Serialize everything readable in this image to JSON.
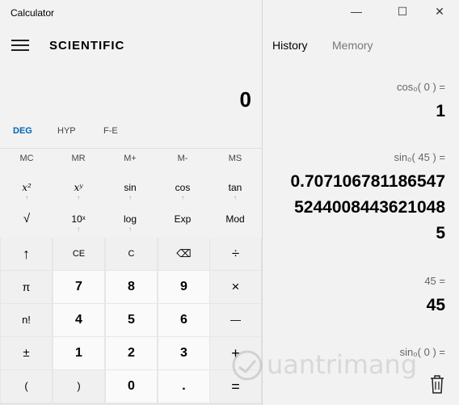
{
  "window": {
    "title": "Calculator",
    "controls": {
      "minimize": "—",
      "maximize": "☐",
      "close": "✕"
    }
  },
  "calculator": {
    "mode": "SCIENTIFIC",
    "display": "0",
    "angle_modes": [
      "DEG",
      "HYP",
      "F-E"
    ],
    "memory_buttons": [
      "MC",
      "MR",
      "M+",
      "M-",
      "MS"
    ],
    "sci_row1": [
      "x²",
      "xʸ",
      "sin",
      "cos",
      "tan"
    ],
    "sci_row2": [
      "√",
      "10ˣ",
      "log",
      "Exp",
      "Mod"
    ],
    "second_arrow": "↑",
    "keypad": [
      [
        "↑",
        "CE",
        "C",
        "⌫",
        "÷"
      ],
      [
        "π",
        "7",
        "8",
        "9",
        "×"
      ],
      [
        "n!",
        "4",
        "5",
        "6",
        "—"
      ],
      [
        "±",
        "1",
        "2",
        "3",
        "+"
      ],
      [
        "(",
        ")",
        "0",
        ".",
        "="
      ]
    ]
  },
  "history_panel": {
    "tabs": {
      "history": "History",
      "memory": "Memory"
    },
    "entries": [
      {
        "expression": "cos₀( 0 ) =",
        "result_lines": [
          "1"
        ]
      },
      {
        "expression": "sin₀( 45 ) =",
        "result_lines": [
          "0.707106781186547",
          "5244008443621048",
          "5"
        ]
      },
      {
        "expression": "45 =",
        "result_lines": [
          "45"
        ]
      },
      {
        "expression": "sin₀( 0 ) =",
        "result_lines": []
      }
    ],
    "delete_icon": "trash-icon"
  },
  "watermark": {
    "text": "uantrimang"
  },
  "colors": {
    "accent": "#0063b1",
    "pane_bg": "#f2f2f2",
    "keypad_bg": "#e6e6e6",
    "digit_key": "#fafafa",
    "op_key": "#f0f0f0"
  }
}
